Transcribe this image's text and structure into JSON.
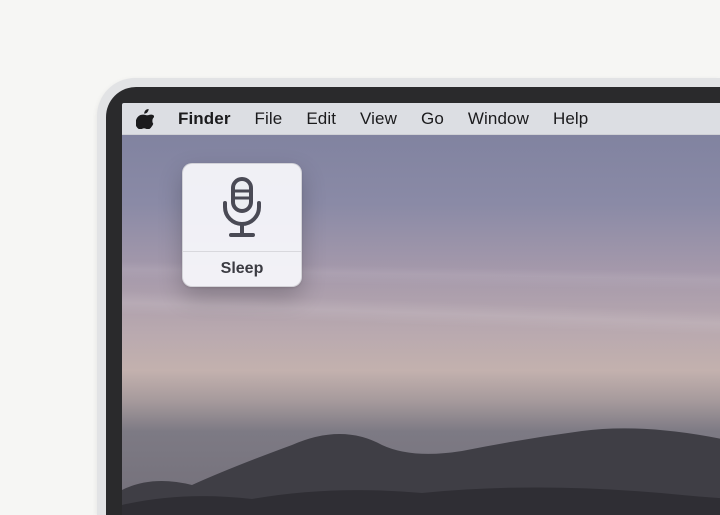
{
  "menubar": {
    "app": "Finder",
    "items": [
      "File",
      "Edit",
      "View",
      "Go",
      "Window",
      "Help"
    ]
  },
  "voice_panel": {
    "status": "Sleep"
  }
}
